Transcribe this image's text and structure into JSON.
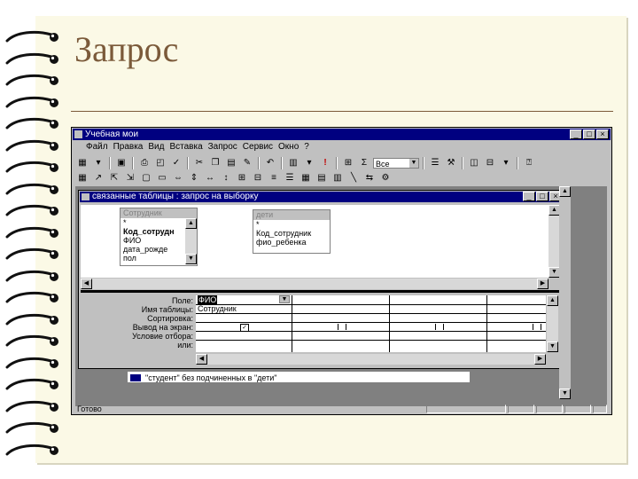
{
  "slide": {
    "title": "Запрос"
  },
  "window": {
    "title": "Учебная мои",
    "controls": [
      "_",
      "□",
      "×"
    ]
  },
  "menu": [
    "Файл",
    "Правка",
    "Вид",
    "Вставка",
    "Запрос",
    "Сервис",
    "Окно",
    "?"
  ],
  "toolbar": {
    "combo_value": "Все"
  },
  "query_window": {
    "title": "связанные таблицы : запрос на выборку",
    "controls": [
      "_",
      "□",
      "×"
    ]
  },
  "tables": [
    {
      "name": "Сотрудник",
      "fields": [
        "*",
        "Код_сотрудн",
        "ФИО",
        "дата_рожде",
        "пол"
      ]
    },
    {
      "name": "дети",
      "fields": [
        "*",
        "Код_сотрудник",
        "фио_ребенка"
      ]
    }
  ],
  "grid": {
    "row_labels": [
      "Поле:",
      "Имя таблицы:",
      "Сортировка:",
      "Вывод на экран:",
      "Условие отбора:",
      "или:"
    ],
    "field_value": "ФИО",
    "table_value": "Сотрудник"
  },
  "bottom_item": "\"студент\" без подчиненных в \"дети\"",
  "status": {
    "text": "Готово"
  },
  "colors": {
    "titlebar": "#000080",
    "slide_title": "#7b5a3a",
    "paper": "#fbf9e6"
  }
}
